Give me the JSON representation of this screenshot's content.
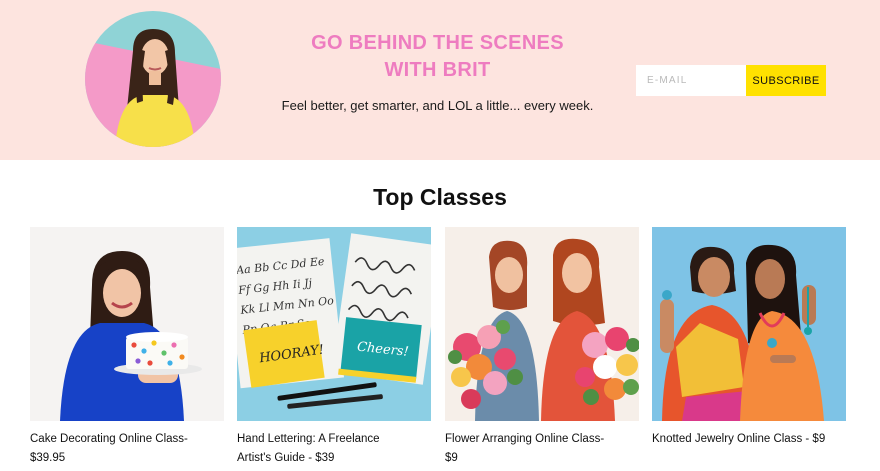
{
  "promo": {
    "title_line1": "GO BEHIND THE SCENES",
    "title_line2": "WITH BRIT",
    "subtitle": "Feel better, get smarter, and LOL a little... every week.",
    "email_placeholder": "E-MAIL",
    "subscribe_label": "SUBSCRIBE",
    "colors": {
      "banner_bg": "#fde4df",
      "title": "#ee7cc0",
      "button": "#ffe100"
    }
  },
  "classes": {
    "heading": "Top Classes",
    "items": [
      {
        "line1": "Cake Decorating Online Class-",
        "line2": "$39.95"
      },
      {
        "line1": "Hand Lettering: A Freelance",
        "line2": "Artist's Guide - $39"
      },
      {
        "line1": "Flower Arranging Online Class-",
        "line2": "$9"
      },
      {
        "line1": "Knotted Jewelry Online Class - $9",
        "line2": ""
      }
    ]
  },
  "lettering": {
    "card_left": "HOORAY!",
    "card_right": "Cheers!",
    "sheet_lines": [
      "Aa Bb Cc Dd Ee",
      "Ff Gg Hh Ii Jj",
      "Kk Ll Mm Nn Oo",
      "Pp Qq Rr Ss"
    ]
  }
}
